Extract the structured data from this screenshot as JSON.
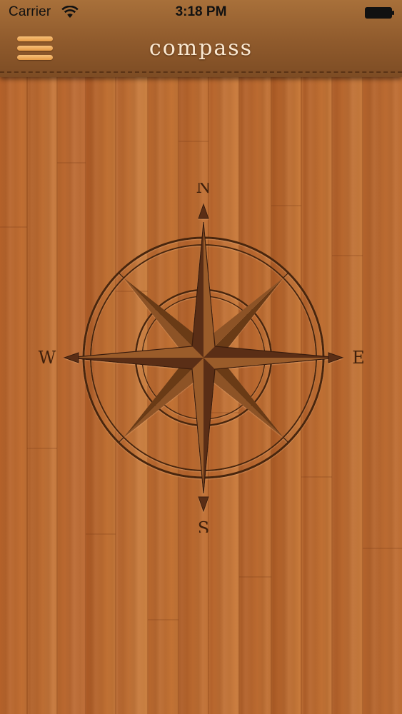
{
  "status_bar": {
    "carrier": "Carrier",
    "time": "3:18 PM",
    "icons": [
      "wifi-icon",
      "battery-icon"
    ]
  },
  "nav_bar": {
    "title": "compass",
    "menu_icon": "hamburger-menu-icon"
  },
  "compass": {
    "north_label": "N",
    "south_label": "S",
    "east_label": "E",
    "west_label": "W"
  },
  "colors": {
    "nav_bar_top": "#a8703a",
    "nav_bar_bottom": "#7d4c24",
    "menu_icon": "#e69a45",
    "title_text": "#fbe9d2",
    "wood": "#c27034",
    "engraving": "#3f200c"
  }
}
